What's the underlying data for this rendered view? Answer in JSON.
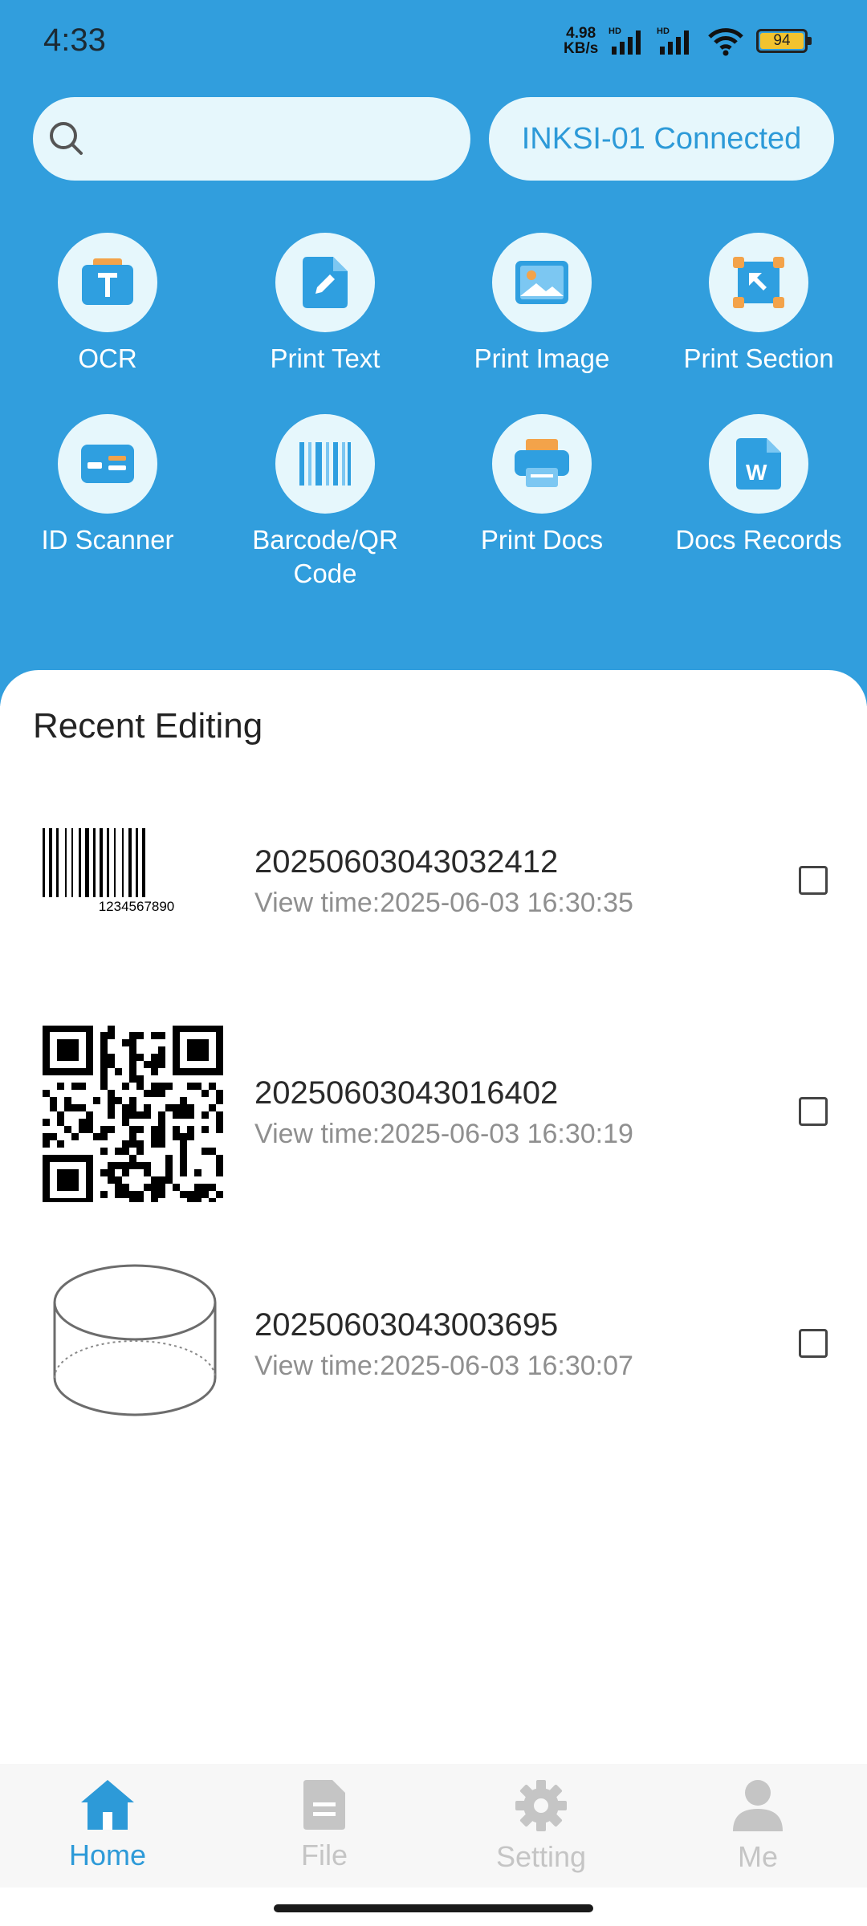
{
  "status": {
    "time": "4:33",
    "rate_top": "4.98",
    "rate_bottom": "KB/s",
    "battery": "94"
  },
  "connection": {
    "label": "INKSI-01 Connected"
  },
  "search": {
    "placeholder": ""
  },
  "tools": [
    {
      "label": "OCR",
      "icon": "ocr-text-icon"
    },
    {
      "label": "Print Text",
      "icon": "edit-document-icon"
    },
    {
      "label": "Print Image",
      "icon": "image-icon"
    },
    {
      "label": "Print Section",
      "icon": "section-select-icon"
    },
    {
      "label": "ID Scanner",
      "icon": "id-card-icon"
    },
    {
      "label": "Barcode/QR\nCode",
      "label_line1": "Barcode/QR",
      "label_line2": "Code",
      "icon": "barcode-icon"
    },
    {
      "label": "Print Docs",
      "icon": "printer-icon"
    },
    {
      "label": "Docs Records",
      "icon": "word-document-icon"
    }
  ],
  "recent": {
    "title": "Recent Editing",
    "items": [
      {
        "name": "20250603043032412",
        "view_time": "View time:2025-06-03 16:30:35",
        "thumb": "barcode",
        "barcode_text": "1234567890"
      },
      {
        "name": "20250603043016402",
        "view_time": "View time:2025-06-03 16:30:19",
        "thumb": "qrcode"
      },
      {
        "name": "20250603043003695",
        "view_time": "View time:2025-06-03 16:30:07",
        "thumb": "cylinder-sketch"
      }
    ]
  },
  "nav": [
    {
      "label": "Home",
      "icon": "home-icon",
      "active": true
    },
    {
      "label": "File",
      "icon": "file-icon",
      "active": false
    },
    {
      "label": "Setting",
      "icon": "gear-icon",
      "active": false
    },
    {
      "label": "Me",
      "icon": "person-icon",
      "active": false
    }
  ],
  "colors": {
    "accent": "#319edd",
    "active_nav": "#2d9ad8",
    "inactive_nav": "#c5c5c5"
  }
}
